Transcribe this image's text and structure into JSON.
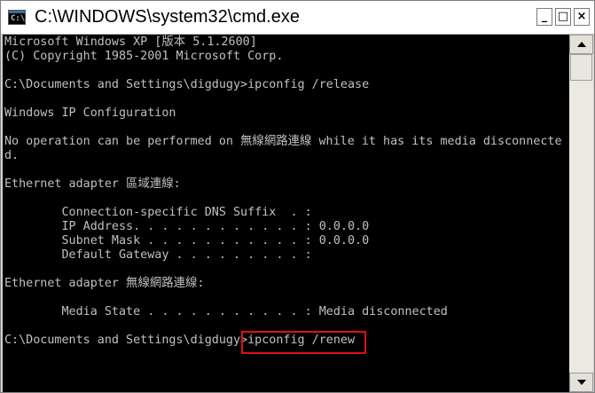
{
  "window": {
    "title": "C:\\WINDOWS\\system32\\cmd.exe",
    "icon": "cmd-icon",
    "controls": {
      "minimize": "_",
      "maximize": "□",
      "close": "×"
    }
  },
  "console": {
    "lines": [
      "Microsoft Windows XP [版本 5.1.2600]",
      "(C) Copyright 1985-2001 Microsoft Corp.",
      "",
      "C:\\Documents and Settings\\digdugy>ipconfig /release",
      "",
      "Windows IP Configuration",
      "",
      "No operation can be performed on 無線網路連線 while it has its media disconnecte",
      "d.",
      "",
      "Ethernet adapter 區域連線:",
      "",
      "        Connection-specific DNS Suffix  . :",
      "        IP Address. . . . . . . . . . . . : 0.0.0.0",
      "        Subnet Mask . . . . . . . . . . . : 0.0.0.0",
      "        Default Gateway . . . . . . . . . :",
      "",
      "Ethernet adapter 無線網路連線:",
      "",
      "        Media State . . . . . . . . . . . : Media disconnected",
      "",
      "C:\\Documents and Settings\\digdugy>ipconfig /renew"
    ],
    "highlighted_command": "ipconfig /renew",
    "highlight_color": "#e01010",
    "text_color": "#c0c0c0",
    "background": "#000000"
  },
  "scrollbar": {
    "up_icon": "arrow-up-icon",
    "down_icon": "arrow-down-icon"
  }
}
